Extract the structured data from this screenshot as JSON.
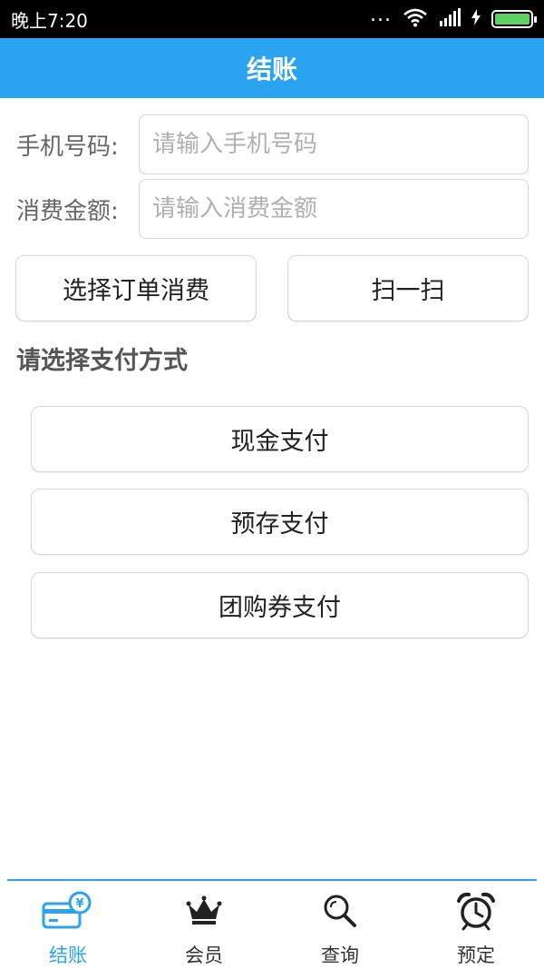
{
  "status_bar": {
    "time": "晚上7:20",
    "dots": "...",
    "battery_color": "#5fd35f"
  },
  "header": {
    "title": "结账"
  },
  "form": {
    "phone": {
      "label": "手机号码:",
      "placeholder": "请输入手机号码",
      "value": ""
    },
    "amount": {
      "label": "消费金额:",
      "placeholder": "请输入消费金额",
      "value": ""
    }
  },
  "actions": {
    "select_order_label": "选择订单消费",
    "scan_label": "扫一扫"
  },
  "payment": {
    "title": "请选择支付方式",
    "options": [
      {
        "label": "现金支付"
      },
      {
        "label": "预存支付"
      },
      {
        "label": "团购券支付"
      }
    ]
  },
  "bottom_nav": {
    "active_color": "#2aa3f0",
    "items": [
      {
        "label": "结账",
        "icon": "card-yen-icon",
        "active": true
      },
      {
        "label": "会员",
        "icon": "crown-icon",
        "active": false
      },
      {
        "label": "查询",
        "icon": "magnifier-icon",
        "active": false
      },
      {
        "label": "预定",
        "icon": "alarm-clock-icon",
        "active": false
      }
    ]
  }
}
